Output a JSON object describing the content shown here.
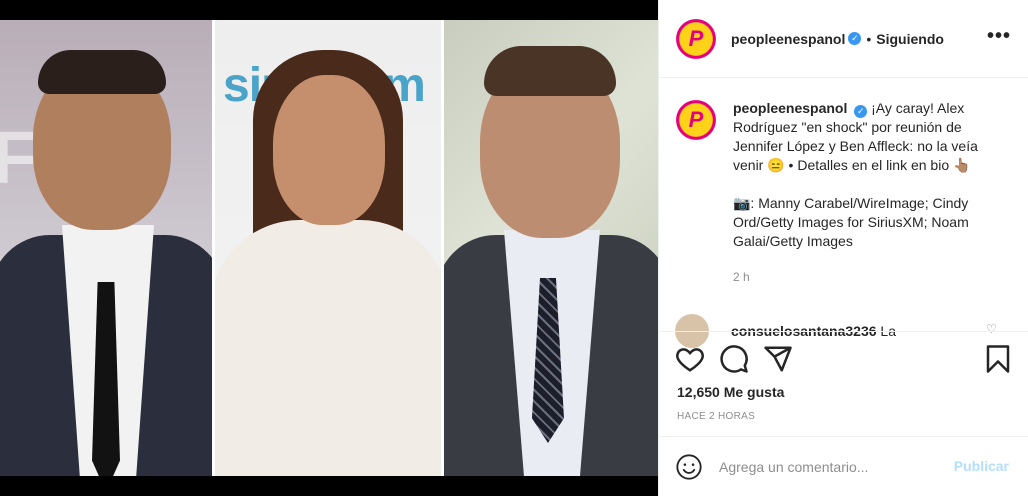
{
  "post": {
    "photo_text": {
      "panel1_bg": "FOX",
      "panel2_bg": "sirius xm"
    }
  },
  "header": {
    "username": "peopleenespanol",
    "separator": "•",
    "follow_status": "Siguiendo",
    "more_label": "•••",
    "avatar_letter": "P"
  },
  "caption": {
    "username": "peopleenespanol",
    "text": "¡Ay caray! Alex Rodríguez \"en shock\" por reunión de Jennifer López y Ben Affleck: no la veía venir 😑 • Detalles en el link en bio 👆🏽",
    "credit": "📷: Manny Carabel/WireImage; Cindy Ord/Getty Images for SiriusXM; Noam Galai/Getty Images",
    "time": "2 h"
  },
  "comment": {
    "username": "consuelosantana3236",
    "text": "La"
  },
  "actions": {
    "likes": "12,650 Me gusta",
    "posted": "HACE 2 HORAS"
  },
  "composer": {
    "placeholder": "Agrega un comentario...",
    "publish_label": "Publicar"
  },
  "colors": {
    "verified": "#3897f0",
    "publish_disabled": "#b2dffc",
    "brand_yellow": "#ffd21a",
    "brand_pink": "#e6007e"
  }
}
